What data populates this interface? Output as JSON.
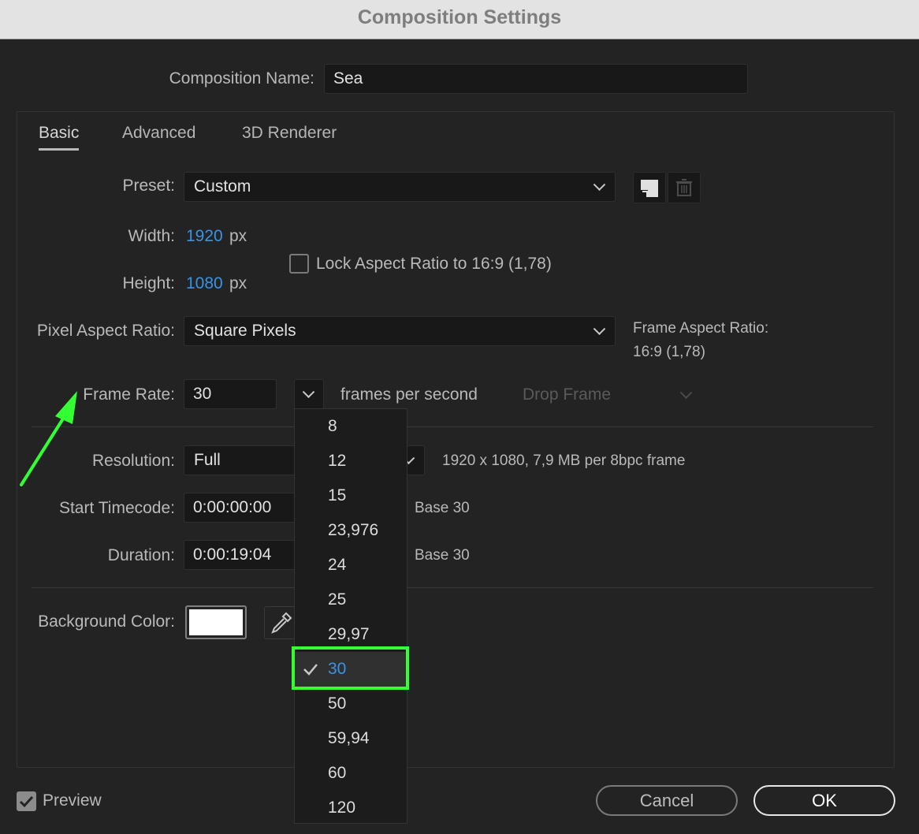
{
  "window": {
    "title": "Composition Settings"
  },
  "comp_name": {
    "label": "Composition Name:",
    "value": "Sea"
  },
  "tabs": [
    {
      "label": "Basic",
      "active": true
    },
    {
      "label": "Advanced",
      "active": false
    },
    {
      "label": "3D Renderer",
      "active": false
    }
  ],
  "preset": {
    "label": "Preset:",
    "value": "Custom"
  },
  "width": {
    "label": "Width:",
    "value": "1920",
    "unit": "px"
  },
  "height": {
    "label": "Height:",
    "value": "1080",
    "unit": "px"
  },
  "lock_aspect": {
    "label": "Lock Aspect Ratio to 16:9 (1,78)",
    "checked": false
  },
  "pixel_aspect": {
    "label": "Pixel Aspect Ratio:",
    "value": "Square Pixels"
  },
  "frame_aspect": {
    "label": "Frame Aspect Ratio:",
    "value": "16:9 (1,78)"
  },
  "frame_rate": {
    "label": "Frame Rate:",
    "value": "30",
    "unit_label": "frames per second",
    "drop_frame": "Drop Frame"
  },
  "resolution": {
    "label": "Resolution:",
    "value": "Full",
    "info": "1920 x 1080, 7,9 MB per 8bpc frame"
  },
  "start_timecode": {
    "label": "Start Timecode:",
    "value": "0:00:00:00",
    "base": "Base 30"
  },
  "duration": {
    "label": "Duration:",
    "value": "0:00:19:04",
    "base": "Base 30"
  },
  "background_color": {
    "label": "Background Color:",
    "color": "#ffffff"
  },
  "frame_rate_menu": {
    "options": [
      "8",
      "12",
      "15",
      "23,976",
      "24",
      "25",
      "29,97",
      "30",
      "50",
      "59,94",
      "60",
      "120"
    ],
    "selected": "30"
  },
  "footer": {
    "preview_label": "Preview",
    "preview_checked": true,
    "cancel_label": "Cancel",
    "ok_label": "OK"
  },
  "colors": {
    "accent": "#3a93e5",
    "annotation": "#33ff33"
  }
}
